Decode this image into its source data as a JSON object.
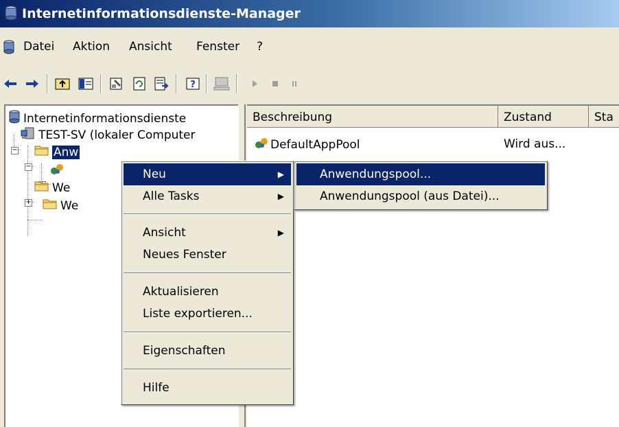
{
  "window": {
    "title": "Internetinformationsdienste-Manager"
  },
  "menubar": {
    "items": [
      "Datei",
      "Aktion",
      "Ansicht",
      "Fenster",
      "?"
    ]
  },
  "toolbar": {
    "buttons": [
      "back-icon",
      "forward-icon",
      "up-folder-icon",
      "show-hide-tree-icon",
      "properties-icon",
      "refresh-icon",
      "export-list-icon",
      "help-icon",
      "computer-icon",
      "play-icon",
      "stop-icon",
      "pause-icon"
    ]
  },
  "tree": {
    "root": "Internetinformationsdienste",
    "computer": "TEST-SV (lokaler Computer",
    "app_pools": "Anw",
    "app_pool_child": "",
    "websites": "We",
    "webservice_ext": "We"
  },
  "list": {
    "columns": [
      "Beschreibung",
      "Zustand",
      "Sta"
    ],
    "rows": [
      {
        "name": "DefaultAppPool",
        "state": "Wird aus..."
      }
    ]
  },
  "context_menu": {
    "items": [
      "Neu",
      "Alle Tasks",
      "Ansicht",
      "Neues Fenster",
      "Aktualisieren",
      "Liste exportieren...",
      "Eigenschaften",
      "Hilfe"
    ],
    "highlighted": "Neu"
  },
  "submenu": {
    "items": [
      "Anwendungspool...",
      "Anwendungspool (aus Datei)..."
    ],
    "highlighted": "Anwendungspool..."
  },
  "colors": {
    "selection": "#0a246a",
    "face": "#ece9d8",
    "title_start": "#0a246a",
    "title_end": "#a6caf0"
  }
}
